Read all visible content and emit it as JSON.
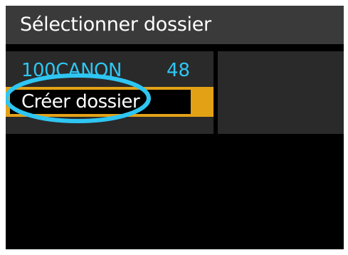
{
  "menu": {
    "title": "Sélectionner dossier",
    "folders": [
      {
        "name": "100CANON",
        "count": "48"
      }
    ],
    "create_folder_label": "Créer dossier"
  },
  "colors": {
    "highlight": "#e3a216",
    "folder_text": "#2ec6f2",
    "annotation_ring": "#2ec6f2",
    "title_bar": "#3a3a3a",
    "panel": "#2a2a2a"
  }
}
